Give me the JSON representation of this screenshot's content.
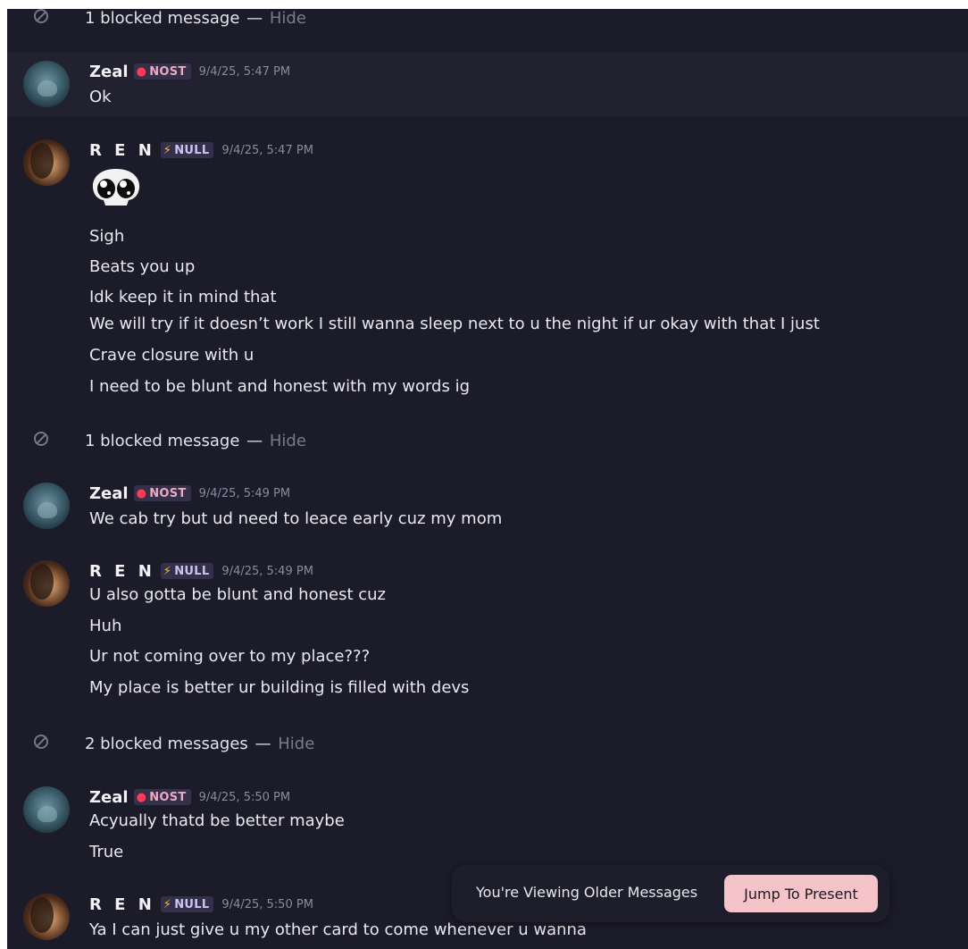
{
  "blocked_groups": [
    {
      "text": "1 blocked message",
      "hide": "Hide"
    },
    {
      "text": "1 blocked message",
      "hide": "Hide"
    },
    {
      "text": "2 blocked messages",
      "hide": "Hide"
    }
  ],
  "messages": [
    {
      "author": "Zeal",
      "tag": "NOST",
      "time": "9/4/25, 5:47 PM",
      "lines": [
        "Ok"
      ]
    },
    {
      "author": "R E N",
      "tag": "NULL",
      "time": "9/4/25, 5:47 PM",
      "sticker": "skull-emoji",
      "lines": [
        "Sigh",
        "Beats you up",
        "Idk keep it in mind that",
        "We will try if it doesn’t work I still wanna sleep next to u the night if ur okay with that I just",
        "Crave closure with u",
        "I need to be blunt and honest with my words ig"
      ]
    },
    {
      "author": "Zeal",
      "tag": "NOST",
      "time": "9/4/25, 5:49 PM",
      "lines": [
        "We cab try but ud need to leace early cuz my mom"
      ]
    },
    {
      "author": "R E N",
      "tag": "NULL",
      "time": "9/4/25, 5:49 PM",
      "lines": [
        "U also gotta be blunt and honest cuz",
        "Huh",
        "Ur not coming over to my place???",
        "My place is better ur building is filled with devs"
      ]
    },
    {
      "author": "Zeal",
      "tag": "NOST",
      "time": "9/4/25, 5:50 PM",
      "lines": [
        "Acyually thatd be better maybe",
        "True"
      ]
    },
    {
      "author": "R E N",
      "tag": "NULL",
      "time": "9/4/25, 5:50 PM",
      "lines": [
        "Ya I can just give u my other card to come whenever u wanna"
      ]
    }
  ],
  "older_bar": {
    "label": "You're Viewing Older Messages",
    "button": "Jump To Present"
  },
  "icons": {
    "blocked": "block-icon",
    "nost_tag": "red-mouth-icon",
    "null_tag": "lightning-icon"
  },
  "colors": {
    "background": "#1c1b2a",
    "jump_button": "#f4c4c8"
  }
}
